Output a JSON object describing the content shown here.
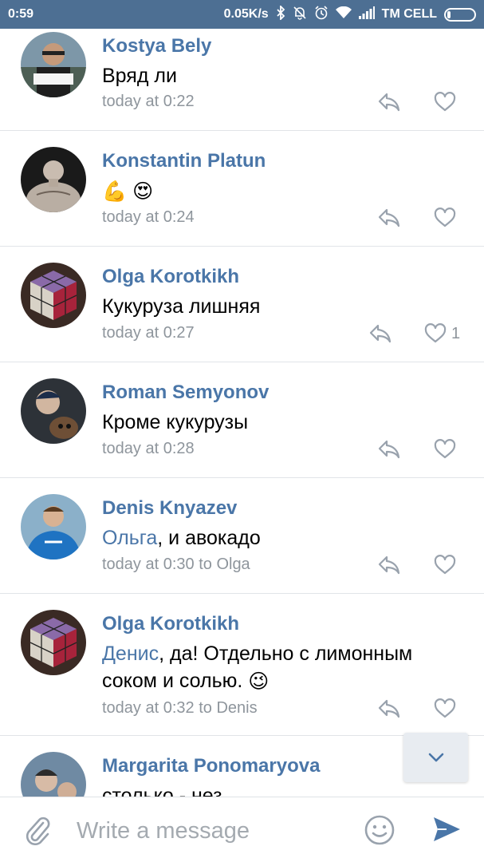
{
  "status_bar": {
    "time": "0:59",
    "net_speed": "0.05K/s",
    "carrier": "TM CELL",
    "icons": [
      "bluetooth-icon",
      "mute-icon",
      "alarm-icon",
      "wifi-icon",
      "signal-icon",
      "battery-icon"
    ]
  },
  "comments": [
    {
      "author": "Kostya Bely",
      "text": "Вряд ли",
      "time": "today at 0:22",
      "likes": ""
    },
    {
      "author": "Konstantin Platun",
      "emoji": [
        "💪",
        "😍"
      ],
      "time": "today at 0:24",
      "likes": ""
    },
    {
      "author": "Olga Korotkikh",
      "text": "Кукуруза лишняя",
      "time": "today at 0:27",
      "likes": "1"
    },
    {
      "author": "Roman Semyonov",
      "text": "Кроме кукурузы",
      "time": "today at 0:28",
      "likes": ""
    },
    {
      "author": "Denis Knyazev",
      "mention": "Ольга",
      "text": ", и авокадо",
      "time": "today at 0:30 to Olga",
      "likes": ""
    },
    {
      "author": "Olga Korotkikh",
      "mention": "Денис",
      "text_line1": ", да! Отдельно с лимонным",
      "text_line2": "соком и солью.",
      "emoji": "😉",
      "time": "today at 0:32 to Denis",
      "likes": ""
    },
    {
      "author": "Margarita Ponomaryova",
      "text": "столько - нез",
      "time": "",
      "likes": ""
    }
  ],
  "composer": {
    "placeholder": "Write a message",
    "icons": [
      "attach-icon",
      "emoji-icon",
      "send-icon"
    ]
  },
  "colors": {
    "status_bar": "#4d6f93",
    "author": "#4a76a8",
    "meta": "#8e959c",
    "accent": "#4a76a8"
  }
}
